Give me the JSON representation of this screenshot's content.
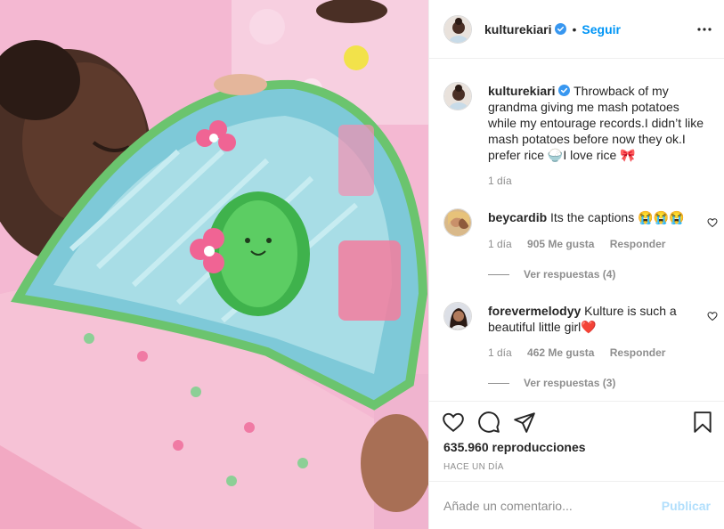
{
  "post": {
    "username": "kulturekiari",
    "separator": "•",
    "follow_label": "Seguir",
    "caption": "Throwback of my grandma giving me mash potatoes while my entourage records.I didn’t like mash potatoes before now they ok.I prefer rice 🍚I love rice 🎀",
    "caption_time": "1 día"
  },
  "comments": [
    {
      "username": "beycardib",
      "text": "Its the captions 😭😭😭",
      "time": "1 día",
      "likes": "905 Me gusta",
      "reply_label": "Responder",
      "view_replies": "Ver respuestas (4)"
    },
    {
      "username": "forevermelodyy",
      "text": "Kulture is such a beautiful little girl❤️",
      "time": "1 día",
      "likes": "462 Me gusta",
      "reply_label": "Responder",
      "view_replies": "Ver respuestas (3)"
    }
  ],
  "stats": {
    "views": "635.960 reproducciones",
    "time_ago": "HACE UN DÍA"
  },
  "composer": {
    "placeholder": "Añade un comentario...",
    "publish_label": "Publicar"
  },
  "icons": {
    "verified": "verified-badge-icon",
    "more": "more-options-icon",
    "like": "heart-icon",
    "comment": "comment-icon",
    "share": "share-icon",
    "save": "bookmark-icon"
  },
  "colors": {
    "link_blue": "#0095f6",
    "publish_disabled": "#b2dffc",
    "muted_text": "#8e8e8e"
  }
}
